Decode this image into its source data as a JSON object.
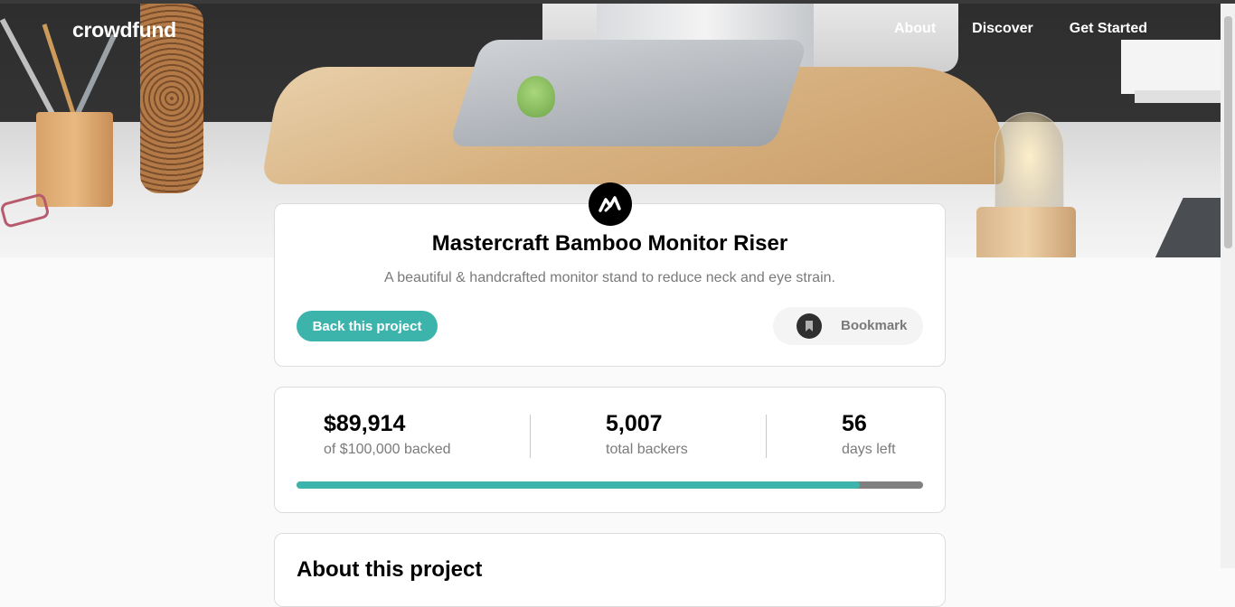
{
  "header": {
    "logo": "crowdfund",
    "nav": [
      "About",
      "Discover",
      "Get Started"
    ]
  },
  "project": {
    "title": "Mastercraft Bamboo Monitor Riser",
    "description": "A beautiful & handcrafted monitor stand to reduce neck and eye strain.",
    "back_button": "Back this project",
    "bookmark_label": "Bookmark",
    "logo_icon": "mastercraft-logo-icon"
  },
  "stats": {
    "backed_value": "$89,914",
    "backed_label": "of $100,000 backed",
    "backers_value": "5,007",
    "backers_label": "total backers",
    "days_value": "56",
    "days_label": "days left",
    "progress_fraction": 0.899
  },
  "about": {
    "title": "About this project"
  },
  "colors": {
    "accent": "#3cb4ac",
    "progress_track": "#808080",
    "text_muted": "#7a7a7a"
  }
}
